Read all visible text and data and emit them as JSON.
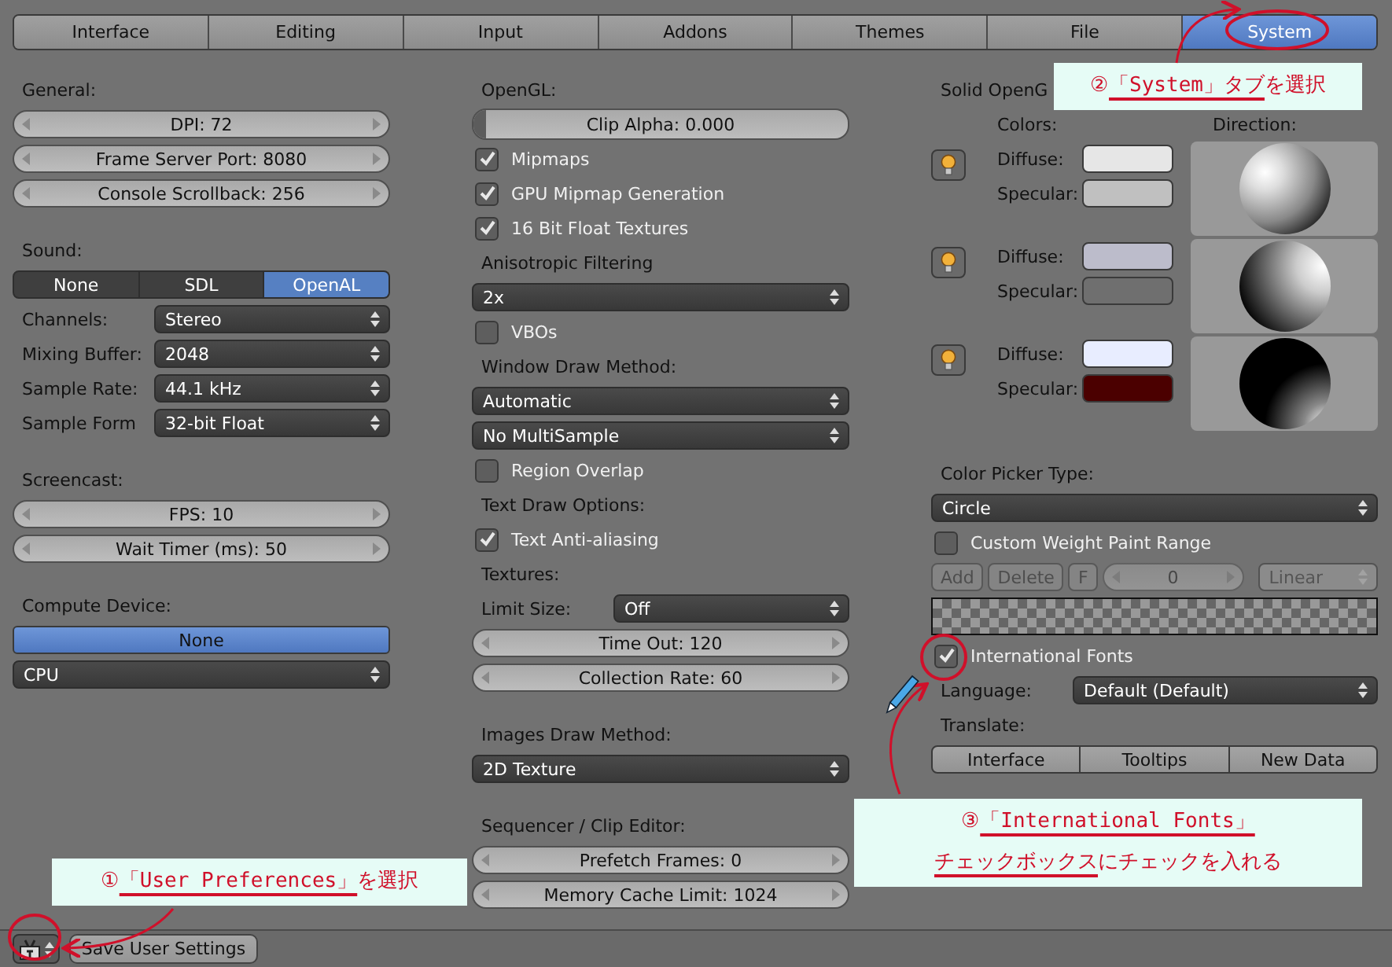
{
  "tabs": [
    {
      "label": "Interface",
      "selected": false
    },
    {
      "label": "Editing",
      "selected": false
    },
    {
      "label": "Input",
      "selected": false
    },
    {
      "label": "Addons",
      "selected": false
    },
    {
      "label": "Themes",
      "selected": false
    },
    {
      "label": "File",
      "selected": false
    },
    {
      "label": "System",
      "selected": true
    }
  ],
  "columns": [
    {
      "sections": [
        [
          {
            "kind": "heading",
            "text": "General:"
          },
          {
            "kind": "number",
            "text": "DPI: 72"
          },
          {
            "kind": "number",
            "text": "Frame Server Port: 8080"
          },
          {
            "kind": "number",
            "text": "Console Scrollback: 256"
          }
        ],
        [
          {
            "kind": "heading",
            "text": "Sound:"
          },
          {
            "kind": "radio",
            "options": [
              {
                "label": "None",
                "selected": false
              },
              {
                "label": "SDL",
                "selected": false
              },
              {
                "label": "OpenAL",
                "selected": true
              }
            ]
          },
          {
            "kind": "field",
            "label": "Channels:",
            "value": "Stereo"
          },
          {
            "kind": "field",
            "label": "Mixing Buffer:",
            "value": "2048"
          },
          {
            "kind": "field",
            "label": "Sample Rate:",
            "value": "44.1 kHz"
          },
          {
            "kind": "field",
            "label": "Sample Form",
            "value": "32-bit Float"
          }
        ],
        [
          {
            "kind": "heading",
            "text": "Screencast:"
          },
          {
            "kind": "number",
            "text": "FPS: 10"
          },
          {
            "kind": "number",
            "text": "Wait Timer (ms): 50"
          }
        ],
        [
          {
            "kind": "heading",
            "text": "Compute Device:"
          },
          {
            "kind": "toggle",
            "text": "None",
            "selected": true
          },
          {
            "kind": "select",
            "value": "CPU"
          }
        ]
      ]
    },
    {
      "sections": [
        [
          {
            "kind": "heading",
            "text": "OpenGL:"
          },
          {
            "kind": "slider",
            "text": "Clip Alpha: 0.000",
            "level": 0.0
          },
          {
            "kind": "check",
            "label": "Mipmaps",
            "checked": true
          },
          {
            "kind": "check",
            "label": "GPU Mipmap Generation",
            "checked": true
          },
          {
            "kind": "check",
            "label": "16 Bit Float Textures",
            "checked": true
          },
          {
            "kind": "heading",
            "text": "Anisotropic Filtering"
          },
          {
            "kind": "select",
            "value": "2x"
          },
          {
            "kind": "check",
            "label": "VBOs",
            "checked": false
          },
          {
            "kind": "heading",
            "text": "Window Draw Method:"
          },
          {
            "kind": "select",
            "value": "Automatic"
          },
          {
            "kind": "select",
            "value": "No MultiSample"
          },
          {
            "kind": "check",
            "label": "Region Overlap",
            "checked": false
          },
          {
            "kind": "heading",
            "text": "Text Draw Options:"
          },
          {
            "kind": "check",
            "label": "Text Anti-aliasing",
            "checked": true
          },
          {
            "kind": "heading",
            "text": "Textures:"
          },
          {
            "kind": "field",
            "label": "Limit Size:",
            "value": "Off"
          },
          {
            "kind": "number",
            "text": "Time Out: 120"
          },
          {
            "kind": "number",
            "text": "Collection Rate: 60"
          }
        ],
        [
          {
            "kind": "heading",
            "text": "Images Draw Method:"
          },
          {
            "kind": "select",
            "value": "2D Texture"
          }
        ],
        [
          {
            "kind": "heading",
            "text": "Sequencer / Clip Editor:"
          },
          {
            "kind": "number",
            "text": "Prefetch Frames: 0"
          },
          {
            "kind": "number",
            "text": "Memory Cache Limit: 1024"
          }
        ]
      ]
    },
    {
      "sections": [
        [
          {
            "kind": "heading",
            "text": "Solid OpenG"
          },
          {
            "kind": "lights",
            "colors_label": "Colors:",
            "direction_label": "Direction:",
            "lights": [
              {
                "diffuse_label": "Diffuse:",
                "specular_label": "Specular:",
                "diffuse": {
                  "color": "#e6e6e6"
                },
                "specular": {
                  "color": "#c0c0c0"
                }
              },
              {
                "diffuse_label": "Diffuse:",
                "specular_label": "Specular:",
                "diffuse": {
                  "color": "#bcbccb"
                },
                "specular": {
                  "color": "#6f6f6f"
                }
              },
              {
                "diffuse_label": "Diffuse:",
                "specular_label": "Specular:",
                "diffuse": {
                  "color": "#e8edff"
                },
                "specular": {
                  "color": "#4b0000"
                }
              }
            ]
          }
        ],
        [
          {
            "kind": "heading",
            "text": "Color Picker Type:"
          },
          {
            "kind": "select",
            "value": "Circle"
          },
          {
            "kind": "check",
            "label": "Custom Weight Paint Range",
            "checked": false
          },
          {
            "kind": "weightrow",
            "disabled": true,
            "buttons": [
              "Add",
              "Delete",
              "F"
            ],
            "number": "0",
            "select": "Linear"
          },
          {
            "kind": "ramp"
          },
          {
            "kind": "check",
            "label": "International Fonts",
            "checked": true
          },
          {
            "kind": "field",
            "label": "Language:",
            "value": "Default (Default)"
          },
          {
            "kind": "heading",
            "text": "Translate:"
          },
          {
            "kind": "buttons",
            "items": [
              {
                "label": "Interface",
                "selected": false
              },
              {
                "label": "Tooltips",
                "selected": false
              },
              {
                "label": "New Data",
                "selected": false
              }
            ]
          }
        ]
      ]
    }
  ],
  "bottom_bar": {
    "save_button": "Save User Settings"
  },
  "annotations": [
    {
      "lines": [
        [
          {
            "text": "①",
            "underline": false
          },
          {
            "text": "「User Preferences」",
            "underline": true
          },
          {
            "text": "を選択",
            "underline": false
          }
        ]
      ]
    },
    {
      "lines": [
        [
          {
            "text": "②",
            "underline": false
          },
          {
            "text": "「System」タブ",
            "underline": true
          },
          {
            "text": "を選択",
            "underline": false
          }
        ]
      ]
    },
    {
      "lines": [
        [
          {
            "text": "③",
            "underline": false
          },
          {
            "text": "「International Fonts」",
            "underline": true
          }
        ],
        [
          {
            "text": "チェックボックス",
            "underline": true
          },
          {
            "text": "にチェックを入れる",
            "underline": false
          }
        ]
      ]
    }
  ]
}
